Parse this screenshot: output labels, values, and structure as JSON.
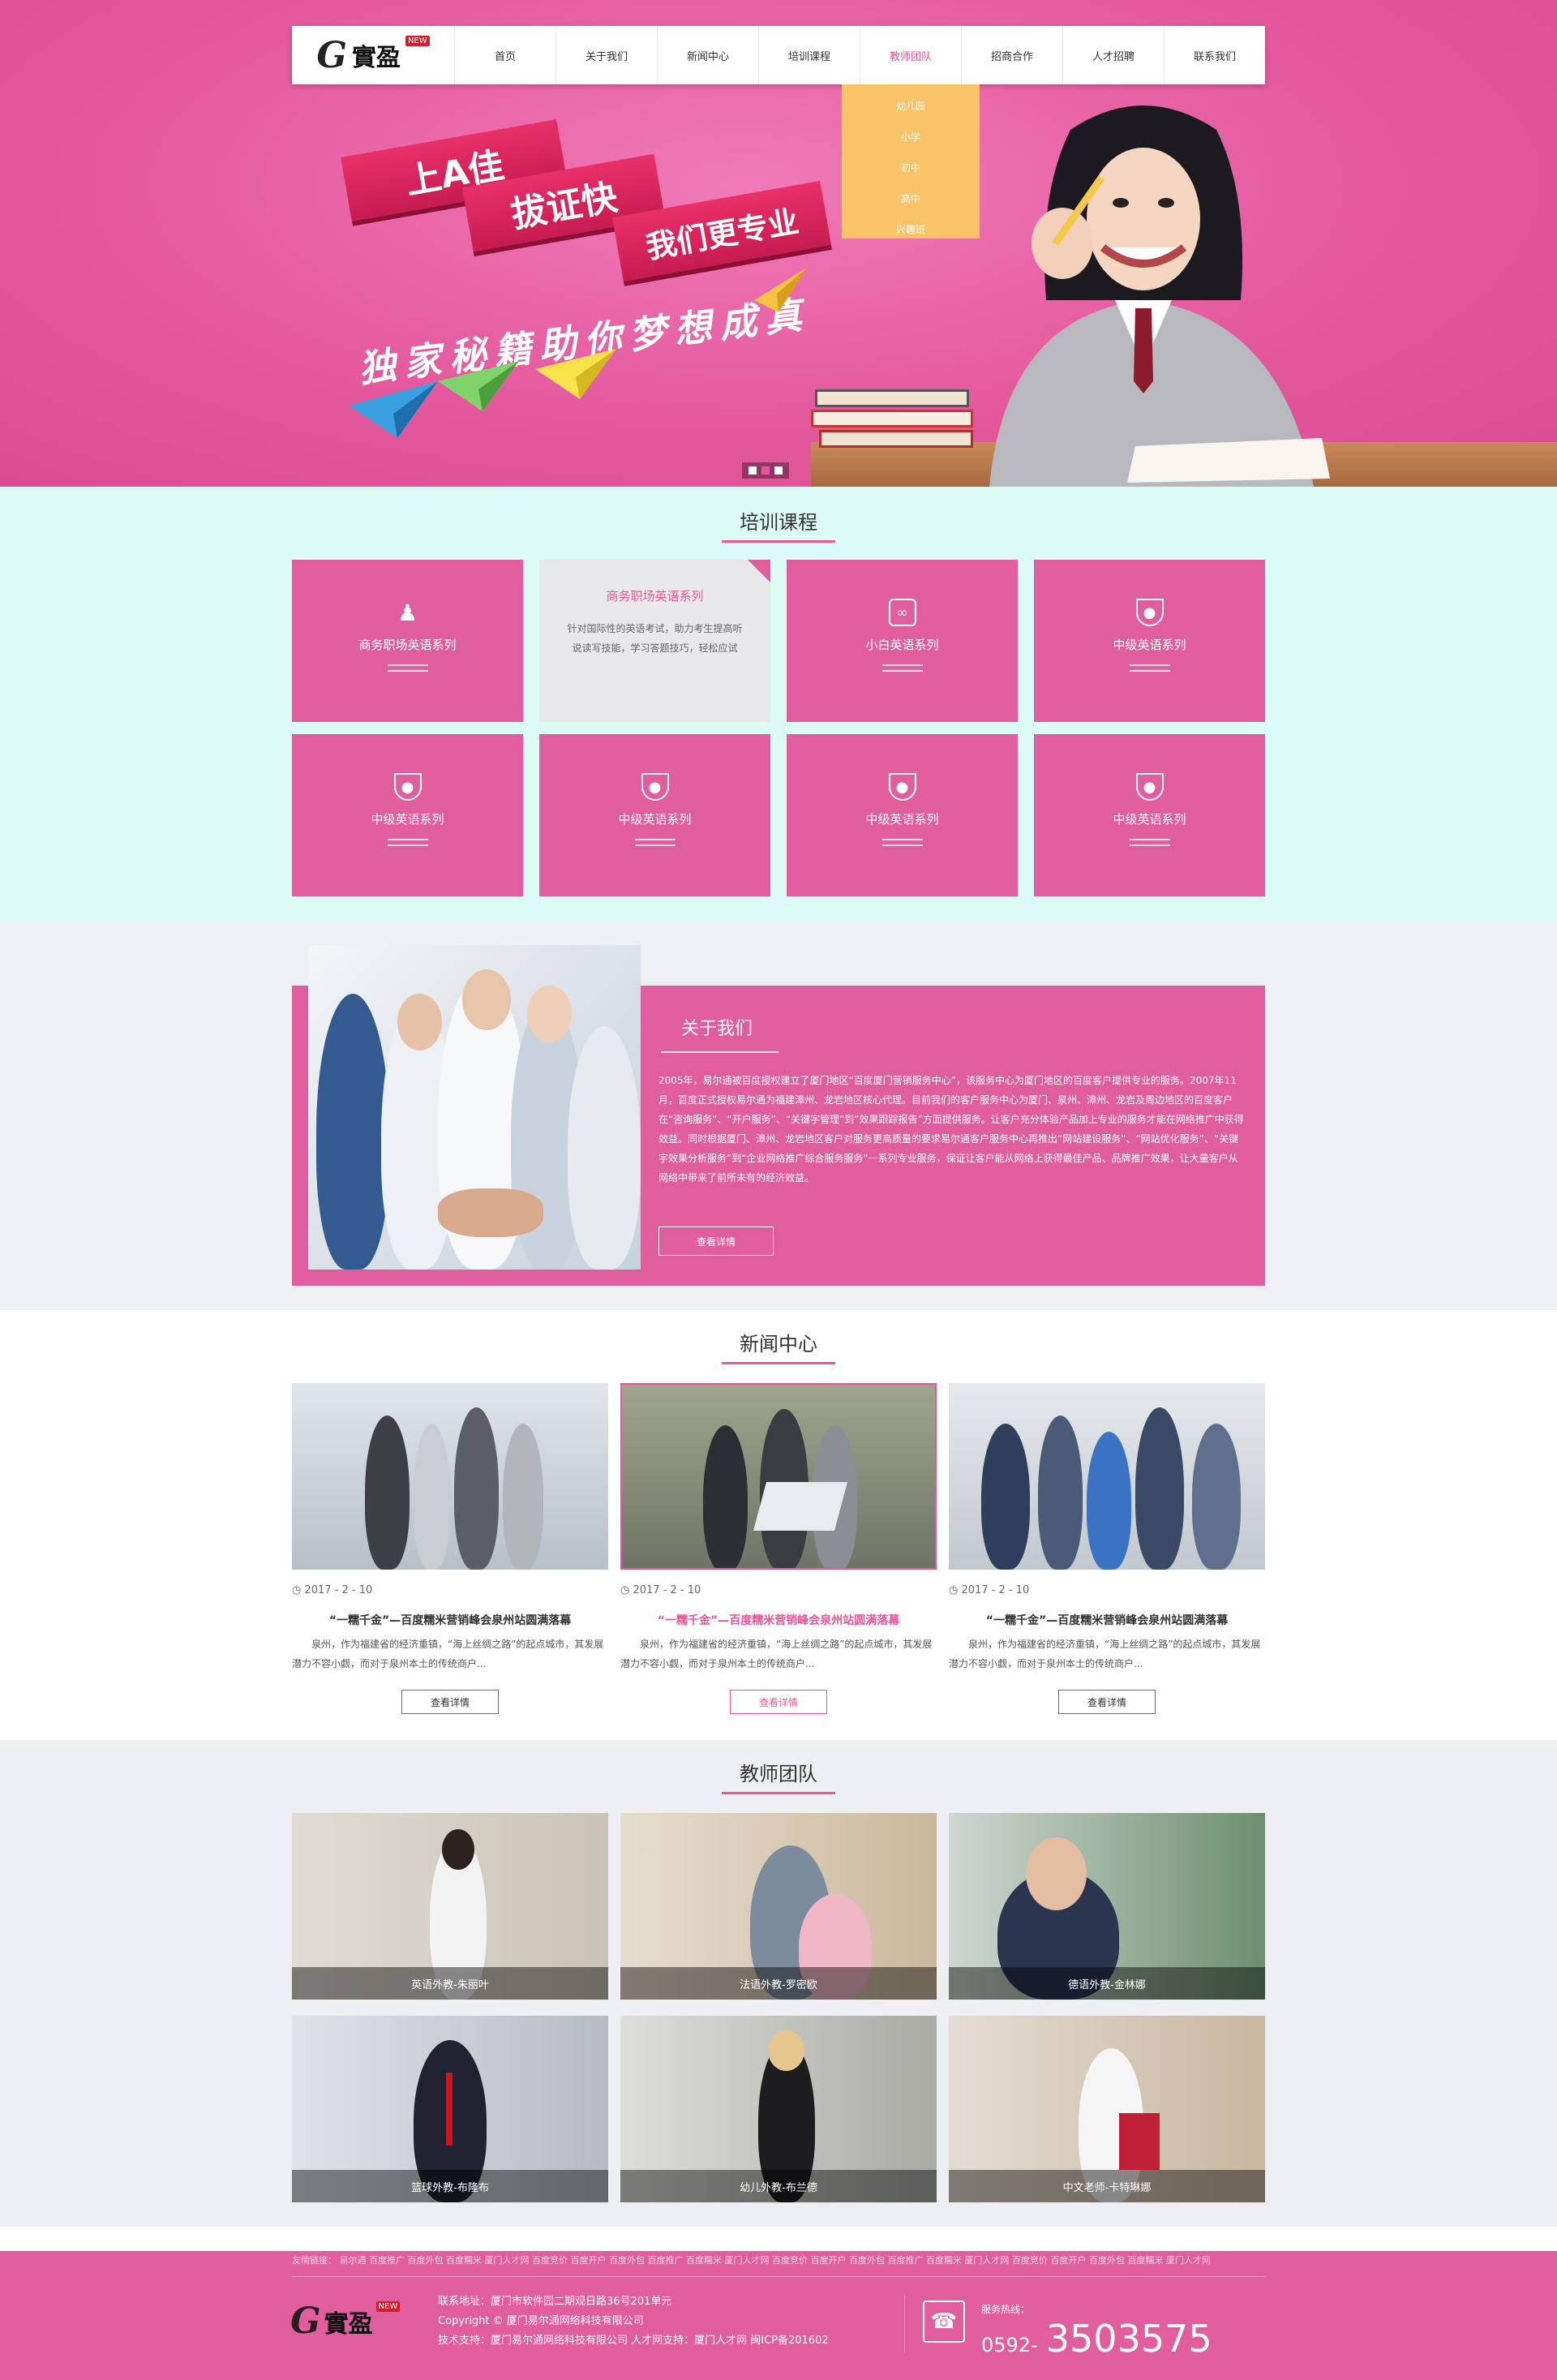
{
  "nav": {
    "logo_text": "實盈",
    "logo_badge": "NEW",
    "items": [
      {
        "label": "首页"
      },
      {
        "label": "关于我们"
      },
      {
        "label": "新闻中心"
      },
      {
        "label": "培训课程"
      },
      {
        "label": "教师团队"
      },
      {
        "label": "招商合作"
      },
      {
        "label": "人才招聘"
      },
      {
        "label": "联系我们"
      }
    ],
    "active_index": 4,
    "dropdown": [
      "幼儿园",
      "小学",
      "初中",
      "高中",
      "兴趣班"
    ]
  },
  "hero": {
    "ribbon1": "上A佳",
    "ribbon2": "拔证快",
    "ribbon3": "我们更专业",
    "slogan": "独家秘籍助你梦想成真",
    "slide_count": 3,
    "active_slide": 1
  },
  "courses": {
    "title": "培训课程",
    "cards": [
      {
        "label": "商务职场英语系列",
        "icon": "user-icon"
      },
      {
        "label": "商务职场英语系列",
        "desc": "针对国际性的英语考试，助力考生提高听说读写技能，学习答题技巧，轻松应试",
        "hover": true
      },
      {
        "label": "小白英语系列",
        "icon": "share-icon"
      },
      {
        "label": "中级英语系列",
        "icon": "shield-icon"
      },
      {
        "label": "中级英语系列",
        "icon": "shield-icon"
      },
      {
        "label": "中级英语系列",
        "icon": "shield-icon"
      },
      {
        "label": "中级英语系列",
        "icon": "shield-icon"
      },
      {
        "label": "中级英语系列",
        "icon": "shield-icon"
      }
    ]
  },
  "about": {
    "title": "关于我们",
    "text": "2005年，易尔通被百度授权建立了厦门地区“百度厦门营销服务中心”，该服务中心为厦门地区的百度客户提供专业的服务。2007年11月，百度正式授权易尔通为福建漳州、龙岩地区核心代理。目前我们的客户服务中心为厦门、泉州、漳州、龙岩及周边地区的百度客户在“咨询服务”、“开户服务”、“关键字管理”到“效果跟踪报告”方面提供服务。让客户充分体验产品加上专业的服务才能在网络推广中获得效益。同时根据厦门、漳州、龙岩地区客户对服务更高质量的要求易尔通客户服务中心再推出“网站建设服务”、“网站优化服务”、“关键字效果分析服务”到“企业网络推广综合服务服务”一系列专业服务，保证让客户能从网络上获得最佳产品、品牌推广效果，让大量客户从网络中带来了前所未有的经济效益。",
    "button": "查看详情"
  },
  "news": {
    "title": "新闻中心",
    "items": [
      {
        "date": "2017 - 2 - 10",
        "title": "“一糯千金”—百度糯米营销峰会泉州站圆满落幕",
        "desc": "泉州，作为福建省的经济重镇，“海上丝绸之路”的起点城市，其发展潜力不容小觑，而对于泉州本土的传统商户...",
        "button": "查看详情"
      },
      {
        "date": "2017 - 2 - 10",
        "title": "“一糯千金”—百度糯米营销峰会泉州站圆满落幕",
        "desc": "泉州，作为福建省的经济重镇，“海上丝绸之路”的起点城市，其发展潜力不容小觑，而对于泉州本土的传统商户...",
        "button": "查看详情"
      },
      {
        "date": "2017 - 2 - 10",
        "title": "“一糯千金”—百度糯米营销峰会泉州站圆满落幕",
        "desc": "泉州，作为福建省的经济重镇，“海上丝绸之路”的起点城市，其发展潜力不容小觑，而对于泉州本土的传统商户...",
        "button": "查看详情"
      }
    ],
    "selected_index": 1
  },
  "teachers": {
    "title": "教师团队",
    "items": [
      {
        "caption": "英语外教-朱丽叶"
      },
      {
        "caption": "法语外教-罗密欧"
      },
      {
        "caption": "德语外教-金林娜"
      },
      {
        "caption": "篮球外教-布隆布"
      },
      {
        "caption": "幼儿外教-布兰德"
      },
      {
        "caption": "中文老师-卡特琳娜"
      }
    ]
  },
  "footer": {
    "links": "友情链接：  易尔通  百度推广  百度外包  百度糯米  厦门人才网  百度竞价  百度开户  百度外包  百度推广  百度糯米  厦门人才网  百度竞价  百度开户  百度外包  百度推广  百度糯米  厦门人才网  百度竞价  百度开户  百度外包  百度糯米  厦门人才网",
    "address": "联系地址：厦门市软件园二期观日路36号201单元",
    "copyright": "Copyright © 厦门易尔通网络科技有限公司",
    "support": "技术支持：厦门易尔通网络科技有限公司        人才网支持：厦门人才网  闽ICP备201602",
    "phone_label": "服务热线：",
    "phone_prefix": "0592-",
    "phone_number": "3503575"
  },
  "colors": {
    "accent": "#e8579a",
    "hero": "#e4599e",
    "card": "#e15e9e",
    "dropdown": "#f9c36a",
    "mint": "#dcfbf4"
  }
}
